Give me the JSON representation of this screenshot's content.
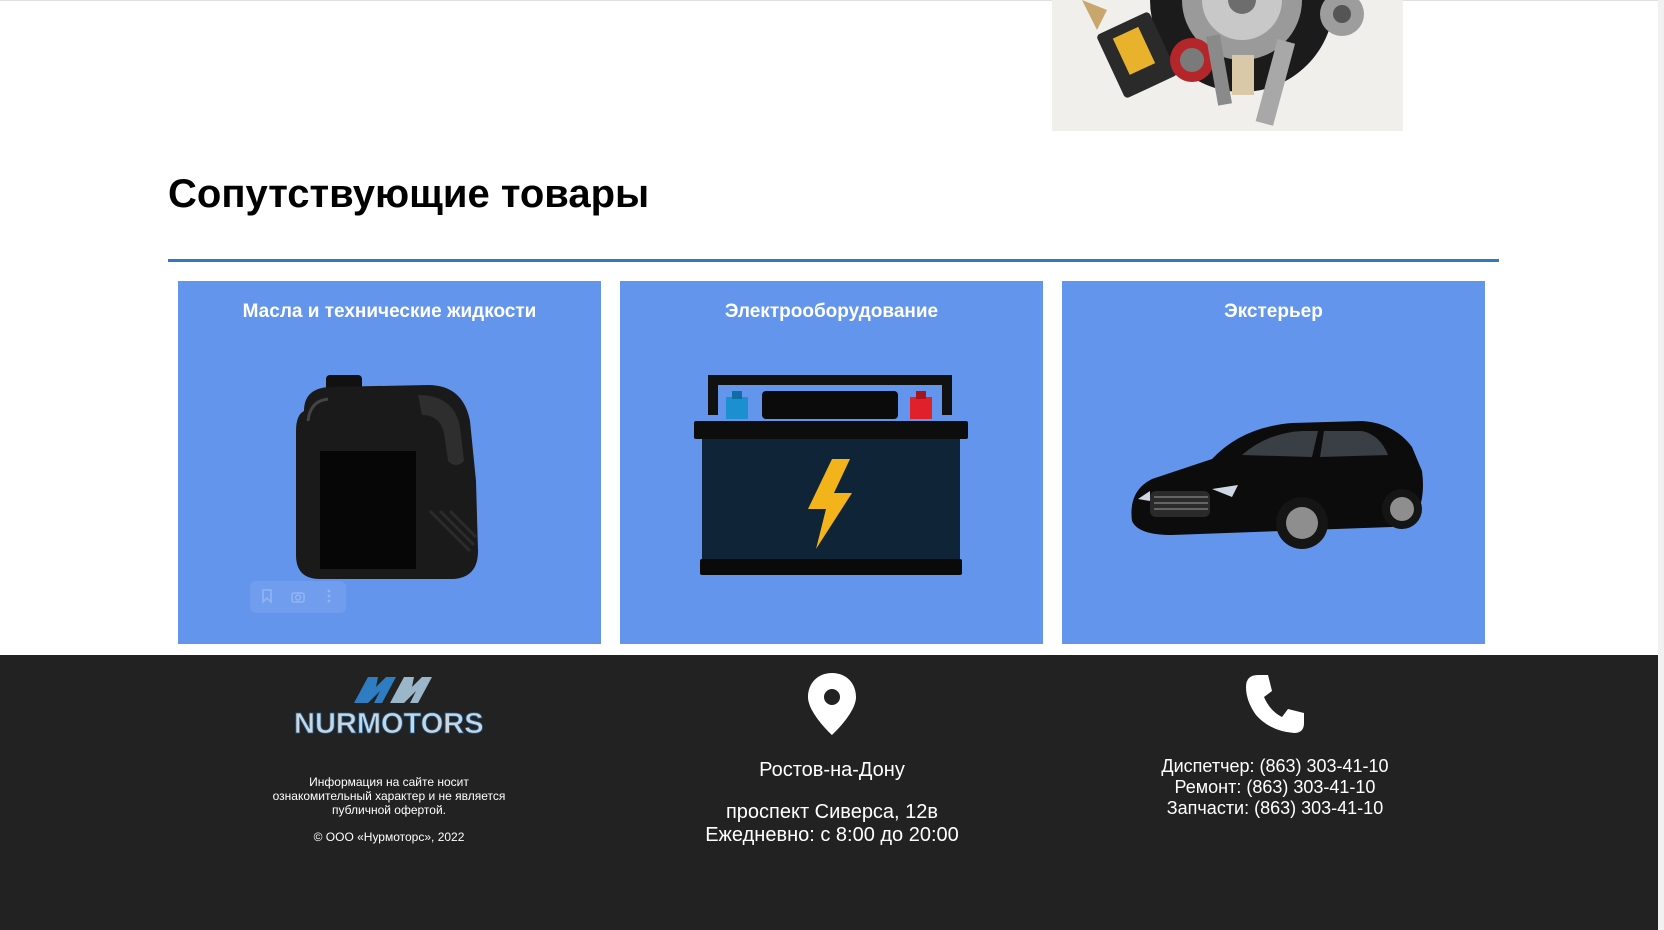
{
  "colors": {
    "card_bg": "#6495ed",
    "accent_rule": "#2f78c4",
    "footer_bg": "#222222",
    "text_light": "#ffffff"
  },
  "hero": {
    "image": "auto-parts-collage"
  },
  "section": {
    "title": "Сопутствующие товары"
  },
  "cards": [
    {
      "label": "Масла и технические жидкости",
      "icon": "oil-canister-icon"
    },
    {
      "label": "Электрооборудование",
      "icon": "car-battery-icon"
    },
    {
      "label": "Экстерьер",
      "icon": "car-icon"
    }
  ],
  "footer": {
    "logo_text": "NURMOTORS",
    "disclaimer": "Информация на сайте носит ознакомительный характер и не является публичной офертой.",
    "copyright": "© ООО «Нурмоторс», 2022",
    "city": "Ростов-на-Дону",
    "address": "проспект Сиверса, 12в",
    "hours": "Ежедневно: с 8:00 до 20:00",
    "phones": [
      "Диспетчер: (863) 303-41-10",
      "Ремонт: (863) 303-41-10",
      "Запчасти: (863) 303-41-10"
    ]
  }
}
